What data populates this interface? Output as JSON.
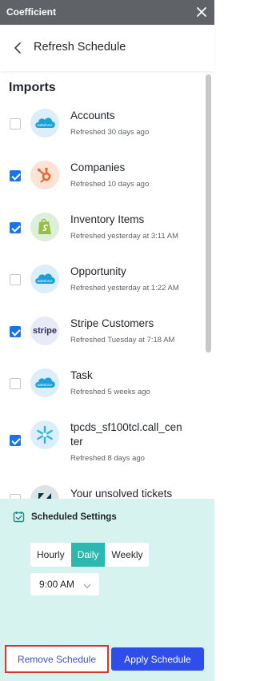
{
  "app": {
    "title": "Coefficient"
  },
  "header": {
    "title": "Refresh Schedule"
  },
  "imports": {
    "title": "Imports",
    "items": [
      {
        "name": "Accounts",
        "refreshed": "Refreshed 30 days ago",
        "checked": false,
        "logo": "salesforce-logo"
      },
      {
        "name": "Companies",
        "refreshed": "Refreshed 10 days ago",
        "checked": true,
        "logo": "hubspot-logo"
      },
      {
        "name": "Inventory Items",
        "refreshed": "Refreshed yesterday at 3:11 AM",
        "checked": true,
        "logo": "shopify-logo"
      },
      {
        "name": "Opportunity",
        "refreshed": "Refreshed yesterday at 1:22 AM",
        "checked": false,
        "logo": "salesforce-logo"
      },
      {
        "name": "Stripe Customers",
        "refreshed": "Refreshed Tuesday at 7:18 AM",
        "checked": true,
        "logo": "stripe-logo"
      },
      {
        "name": "Task",
        "refreshed": "Refreshed 5 weeks ago",
        "checked": false,
        "logo": "salesforce-logo"
      },
      {
        "name_line1": "tpcds_sf100tcl.call_cen",
        "name_line2": "ter",
        "refreshed": "Refreshed 8 days ago",
        "checked": true,
        "logo": "snowflake-logo"
      },
      {
        "name": "Your unsolved tickets",
        "checked": false,
        "logo": "zendesk-logo"
      }
    ],
    "logo_text": {
      "salesforce": "salesforce",
      "stripe": "stripe"
    }
  },
  "schedule": {
    "title": "Scheduled Settings",
    "frequencies": [
      "Hourly",
      "Daily",
      "Weekly"
    ],
    "selected_frequency": "Daily",
    "time": "9:00 AM"
  },
  "buttons": {
    "remove": "Remove Schedule",
    "apply": "Apply Schedule"
  },
  "colors": {
    "topbar": "#5f6368",
    "accent_teal": "#2bb8b0",
    "panel_bg": "#d6f3ef",
    "primary_blue": "#2f4de8",
    "checkbox_blue": "#1a73e8",
    "highlight_red": "#d9352b"
  }
}
